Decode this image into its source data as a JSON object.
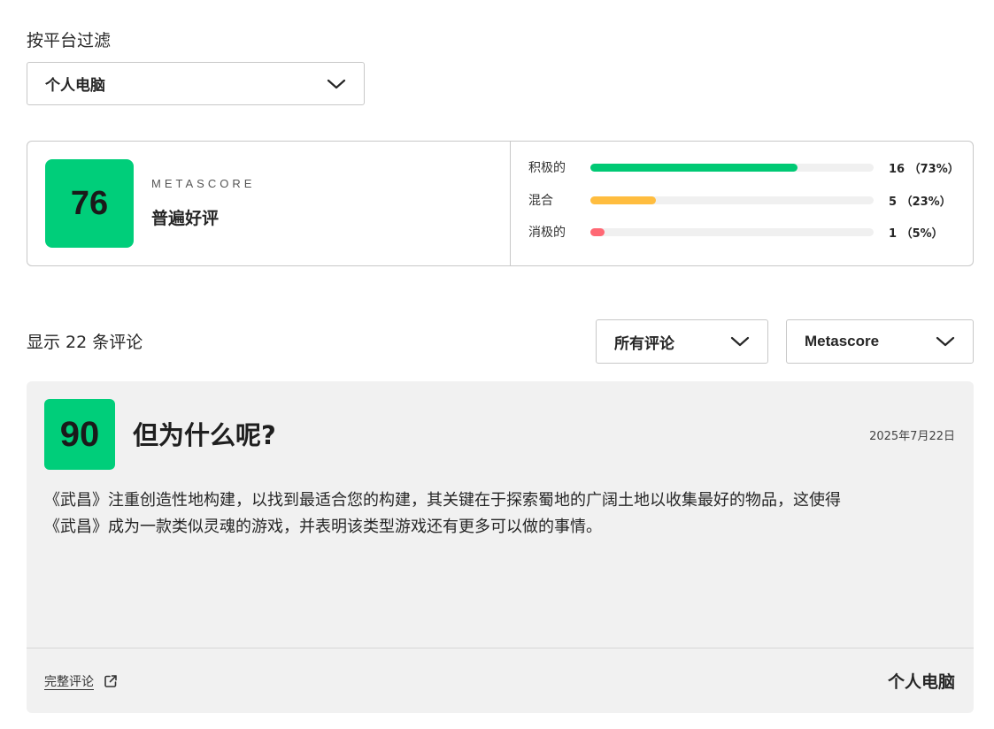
{
  "filter": {
    "label": "按平台过滤",
    "platform_value": "个人电脑"
  },
  "summary": {
    "score": "76",
    "score_color": "#00ce7a",
    "metascore_label": "METASCORE",
    "description": "普遍好评",
    "distribution": [
      {
        "label": "积极的",
        "count_text": "16 （73%）",
        "fraction": 0.73,
        "color": "#00c974"
      },
      {
        "label": "混合",
        "count_text": "5 （23%）",
        "fraction": 0.23,
        "color": "#ffbd3f"
      },
      {
        "label": "消极的",
        "count_text": "1 （5%）",
        "fraction": 0.05,
        "color": "#ff6874"
      }
    ]
  },
  "list": {
    "count_text": "显示 22 条评论",
    "filter_value": "所有评论",
    "sort_value": "Metascore"
  },
  "review": {
    "score": "90",
    "score_color": "#00ce7a",
    "title": "但为什么呢?",
    "date": "2025年7月22日",
    "body_line1": "《武昌》注重创造性地构建，以找到最适合您的构建，其关键在于探索蜀地的广阔土地以收集最好的物品，这使得",
    "body_line2": "《武昌》成为一款类似灵魂的游戏，并表明该类型游戏还有更多可以做的事情。",
    "full_review_link": "完整评论",
    "platform": "个人电脑",
    "icons": {
      "external": "external-link-icon"
    }
  }
}
